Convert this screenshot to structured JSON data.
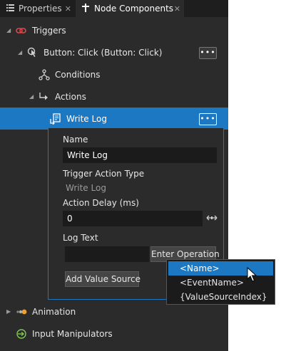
{
  "tabs": [
    {
      "label": "Properties",
      "icon": "properties-icon",
      "active": false
    },
    {
      "label": "Node Components",
      "icon": "node-components-icon",
      "active": true
    }
  ],
  "tree": {
    "triggers": {
      "label": "Triggers",
      "icon": "triggers-icon"
    },
    "trigger": {
      "label": "Button: Click (Button: Click)",
      "icon": "button-click-icon",
      "menu": "•••"
    },
    "conditions": {
      "label": "Conditions",
      "icon": "conditions-icon"
    },
    "actions": {
      "label": "Actions",
      "icon": "actions-icon"
    },
    "write_log": {
      "label": "Write Log",
      "icon": "write-log-icon",
      "menu": "•••"
    },
    "animation": {
      "label": "Animation",
      "icon": "animation-icon"
    },
    "input_manipulators": {
      "label": "Input Manipulators",
      "icon": "input-manipulators-icon"
    }
  },
  "editor": {
    "name_label": "Name",
    "name_value": "Write Log",
    "type_label": "Trigger Action Type",
    "type_value": "Write Log",
    "delay_label": "Action Delay (ms)",
    "delay_value": "0",
    "log_text_label": "Log Text",
    "log_text_value": "",
    "enter_operation": "Enter Operation",
    "add_value_source": "Add Value Source"
  },
  "dropdown": {
    "items": [
      "<Name>",
      "<EventName>",
      "{ValueSourceIndex}"
    ],
    "highlighted": "<Name>"
  },
  "colors": {
    "selection": "#1d78c4",
    "panel_bg": "#2b2b2b",
    "field_bg": "#1b1b1b",
    "trigger_red": "#e0474c",
    "animation_orange": "#f0a030",
    "manipulator_green": "#7ec850"
  }
}
